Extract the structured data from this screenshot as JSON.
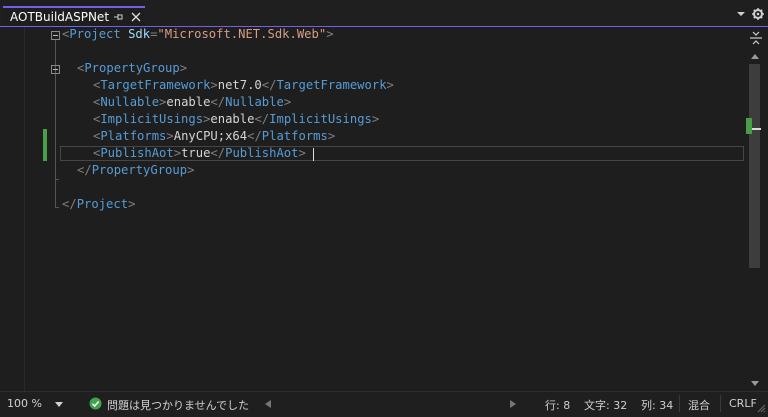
{
  "tab": {
    "title": "AOTBuildASPNet"
  },
  "colors": {
    "accent": "#7160e8",
    "change_bar": "#4a9e4a",
    "tag": "#569cd6",
    "attribute": "#9cdcfe",
    "string": "#d69d85"
  },
  "code": {
    "line1": {
      "b1": "<",
      "tag": "Project",
      "sp": " ",
      "attr": "Sdk",
      "eq": "=",
      "val": "\"Microsoft.NET.Sdk.Web\"",
      "b2": ">"
    },
    "line3": {
      "b1": "<",
      "tag": "PropertyGroup",
      "b2": ">"
    },
    "line4": {
      "b1": "<",
      "tag": "TargetFramework",
      "b2": ">",
      "text": "net7.0",
      "b3": "</",
      "tag2": "TargetFramework",
      "b4": ">"
    },
    "line5": {
      "b1": "<",
      "tag": "Nullable",
      "b2": ">",
      "text": "enable",
      "b3": "</",
      "tag2": "Nullable",
      "b4": ">"
    },
    "line6": {
      "b1": "<",
      "tag": "ImplicitUsings",
      "b2": ">",
      "text": "enable",
      "b3": "</",
      "tag2": "ImplicitUsings",
      "b4": ">"
    },
    "line7": {
      "b1": "<",
      "tag": "Platforms",
      "b2": ">",
      "text": "AnyCPU;x64",
      "b3": "</",
      "tag2": "Platforms",
      "b4": ">"
    },
    "line8": {
      "b1": "<",
      "tag": "PublishAot",
      "b2": ">",
      "text": "true",
      "b3": "</",
      "tag2": "PublishAot",
      "b4": ">"
    },
    "line9": {
      "b1": "</",
      "tag": "PropertyGroup",
      "b2": ">"
    },
    "line11": {
      "b1": "</",
      "tag": "Project",
      "b2": ">"
    }
  },
  "statusbar": {
    "zoom": "100 %",
    "issues": "問題は見つかりませんでした",
    "line": "行: 8",
    "char": "文字: 32",
    "col": "列: 34",
    "whitespace": "混合",
    "line_ending": "CRLF"
  }
}
